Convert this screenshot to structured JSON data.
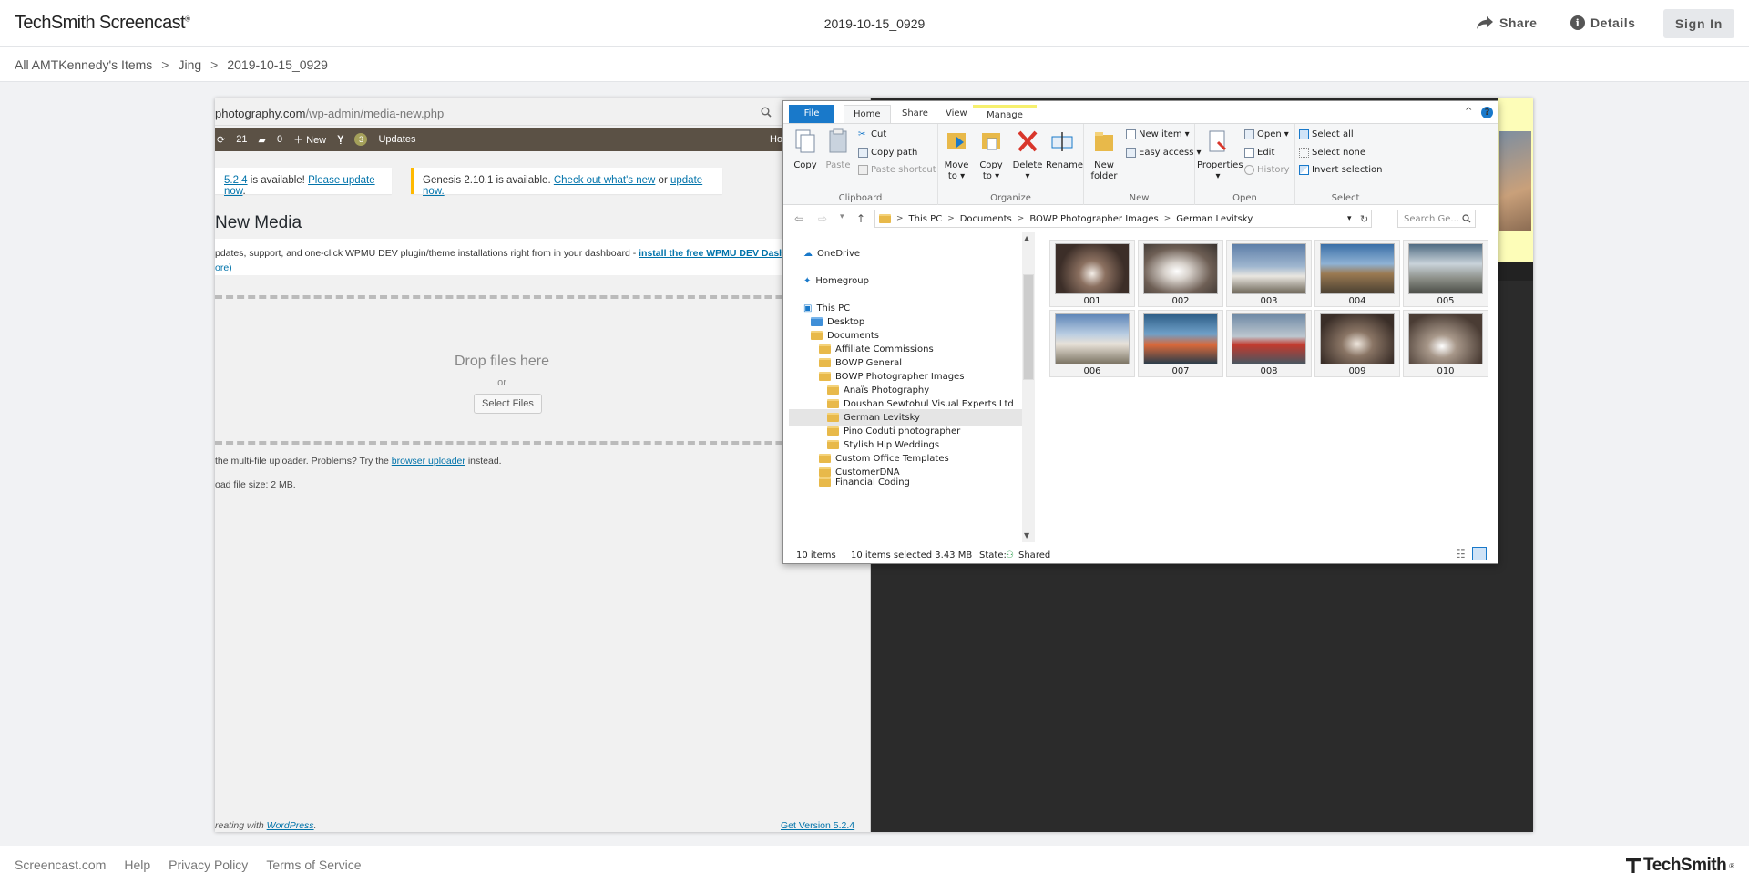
{
  "header": {
    "logo": "TechSmith Screencast",
    "logo_mark": "®",
    "doc_title": "2019-10-15_0929",
    "share": "Share",
    "details": "Details",
    "sign_in": "Sign In",
    "share_icon": "share-arrow-icon",
    "details_icon": "info-icon",
    "details_icon_char": "i"
  },
  "breadcrumb": {
    "items": [
      "All AMTKennedy's Items",
      "Jing",
      "2019-10-15_0929"
    ],
    "separator": ">"
  },
  "capture": {
    "wordpress": {
      "url_host": "photography.com",
      "url_path": "/wp-admin/media-new.php",
      "admin_bar": {
        "comments_count": "21",
        "bubble_count": "0",
        "new": "New",
        "yoast_count": "3",
        "updates": "Updates",
        "howdy": "Ho"
      },
      "notice1": {
        "version": "5.2.4",
        "text": " is available! ",
        "link": "Please update now",
        "end": "."
      },
      "notice2": {
        "text": "Genesis 2.10.1 is available. ",
        "link1": "Check out what's new",
        "or": " or ",
        "link2": "update now."
      },
      "heading": "New Media",
      "wpmudev_text": "pdates, support, and one-click WPMU DEV plugin/theme installations right from in your dashboard - ",
      "wpmudev_link": "install the free WPMU DEV Dashbo",
      "wpmudev_more": "ore)",
      "drop_text": "Drop files here",
      "or": "or",
      "select_files": "Select Files",
      "uploader_note_a": "the multi-file uploader. Problems? Try the ",
      "uploader_note_link": "browser uploader",
      "uploader_note_b": " instead.",
      "max_size": "oad file size: 2 MB.",
      "footer_left_a": "reating with ",
      "footer_left_link": "WordPress",
      "footer_left_end": ".",
      "footer_right": "Get Version 5.2.4"
    },
    "explorer": {
      "tabs": [
        "File",
        "Home",
        "Share",
        "View",
        "Manage"
      ],
      "minimize_glyph": "^",
      "help_glyph": "?",
      "clipboard": {
        "copy": "Copy",
        "paste": "Paste",
        "cut": "Cut",
        "copy_path": "Copy path",
        "paste_shortcut": "Paste shortcut",
        "label": "Clipboard"
      },
      "organize": {
        "move_to": "Move",
        "move_to_2": "to",
        "copy_to": "Copy",
        "copy_to_2": "to",
        "delete": "Delete",
        "rename": "Rename",
        "label": "Organize"
      },
      "new": {
        "new_folder": "New",
        "new_folder_2": "folder",
        "new_item": "New item",
        "easy_access": "Easy access",
        "label": "New"
      },
      "open": {
        "properties": "Properties",
        "open": "Open",
        "edit": "Edit",
        "history": "History",
        "label": "Open"
      },
      "select": {
        "select_all": "Select all",
        "select_none": "Select none",
        "invert": "Invert selection",
        "label": "Select"
      },
      "path": [
        "This PC",
        "Documents",
        "BOWP Photographer Images",
        "German Levitsky"
      ],
      "path_sep": ">",
      "search_placeholder": "Search Ge...",
      "nav": {
        "onedrive": "OneDrive",
        "homegroup": "Homegroup",
        "thispc": "This PC",
        "desktop": "Desktop",
        "documents": "Documents",
        "folders": [
          "Affiliate Commissions",
          "BOWP General",
          "BOWP Photographer Images",
          "Anaïs Photography",
          "Doushan Sewtohul Visual Experts Ltd",
          "German Levitsky",
          "Pino Coduti photographer",
          "Stylish Hip Weddings",
          "Custom Office Templates",
          "CustomerDNA",
          "Financial Coding"
        ]
      },
      "thumbnails": [
        "001",
        "002",
        "003",
        "004",
        "005",
        "006",
        "007",
        "008",
        "009",
        "010"
      ],
      "status": {
        "items": "10 items",
        "selected": "10 items selected  3.43 MB",
        "state_label": "State:",
        "state_value": "Shared"
      }
    }
  },
  "footer": {
    "links": [
      "Screencast.com",
      "Help",
      "Privacy Policy",
      "Terms of Service"
    ],
    "brand": "TechSmith",
    "brand_mark": "®"
  },
  "colors": {
    "accent_blue": "#1979ca",
    "wp_admin_bar": "#5b5145",
    "manage_tab_yellow": "#f6f06e",
    "link_blue": "#0073aa"
  }
}
